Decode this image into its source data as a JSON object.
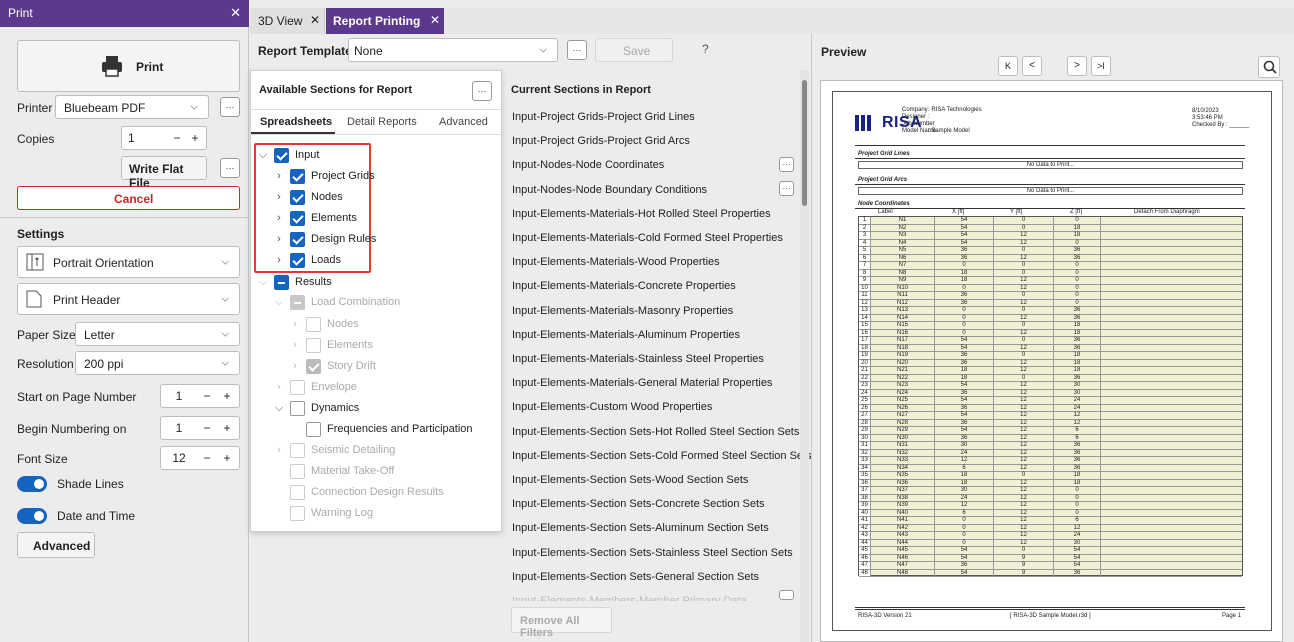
{
  "left_panel": {
    "title": "Print",
    "close": "✕",
    "print_button": "Print",
    "printer_label": "Printer",
    "printer_value": "Bluebeam PDF",
    "copies_label": "Copies",
    "copies_value": "1",
    "write_flat_file": "Write Flat File",
    "cancel": "Cancel",
    "settings_header": "Settings",
    "orientation": "Portrait Orientation",
    "print_header": "Print Header",
    "paper_size_label": "Paper Size",
    "paper_size_value": "Letter",
    "resolution_label": "Resolution",
    "resolution_value": "200 ppi",
    "start_page_label": "Start on Page Number",
    "start_page_value": "1",
    "begin_numbering_label": "Begin Numbering on",
    "begin_numbering_value": "1",
    "font_size_label": "Font Size",
    "font_size_value": "12",
    "shade_lines": "Shade Lines",
    "date_time": "Date and Time",
    "advanced": "Advanced",
    "minus": "−",
    "plus": "+",
    "ellipsis": "···"
  },
  "tabs": [
    {
      "label": "3D View",
      "close": "✕"
    },
    {
      "label": "Report Printing",
      "close": "✕"
    }
  ],
  "toolbar": {
    "templates_label": "Report Templates",
    "templates_value": "None",
    "save": "Save",
    "help": "?"
  },
  "available": {
    "title": "Available Sections for Report",
    "tabs": [
      "Spreadsheets",
      "Detail Reports",
      "Advanced"
    ],
    "tree": [
      "Input",
      "Project Grids",
      "Nodes",
      "Elements",
      "Design Rules",
      "Loads",
      "Results",
      "Load Combination",
      "Nodes",
      "Elements",
      "Story Drift",
      "Envelope",
      "Dynamics",
      "Frequencies and Participation",
      "Seismic Detailing",
      "Material Take-Off",
      "Connection Design Results",
      "Warning Log"
    ]
  },
  "current": {
    "title": "Current Sections in Report",
    "items": [
      "Input-Project Grids-Project Grid Lines",
      "Input-Project Grids-Project Grid Arcs",
      "Input-Nodes-Node Coordinates",
      "Input-Nodes-Node Boundary Conditions",
      "Input-Elements-Materials-Hot Rolled Steel Properties",
      "Input-Elements-Materials-Cold Formed Steel Properties",
      "Input-Elements-Materials-Wood Properties",
      "Input-Elements-Materials-Concrete Properties",
      "Input-Elements-Materials-Masonry Properties",
      "Input-Elements-Materials-Aluminum Properties",
      "Input-Elements-Materials-Stainless Steel Properties",
      "Input-Elements-Materials-General Material Properties",
      "Input-Elements-Custom Wood Properties",
      "Input-Elements-Section Sets-Hot Rolled Steel Section Sets",
      "Input-Elements-Section Sets-Cold Formed Steel Section Sets",
      "Input-Elements-Section Sets-Wood Section Sets",
      "Input-Elements-Section Sets-Concrete Section Sets",
      "Input-Elements-Section Sets-Aluminum Section Sets",
      "Input-Elements-Section Sets-Stainless Steel Section Sets",
      "Input-Elements-Section Sets-General Section Sets",
      "Input-Elements-Members-Member Primary Data"
    ],
    "remove_all": "Remove All Filters"
  },
  "preview": {
    "title": "Preview",
    "nav": [
      "K",
      "<",
      ">",
      ">I"
    ],
    "logo": "RISA",
    "company_labels": [
      "Company",
      "Designer",
      "Job Number",
      "Model Name"
    ],
    "company_values": [
      ": RISA Technologies",
      ":",
      ":",
      ": Sample Model"
    ],
    "date": "8/10/2023",
    "time": "3:53:46 PM",
    "checked_by": "Checked By :",
    "grid_lines_title": "Project Grid Lines",
    "grid_arcs_title": "Project Grid Arcs",
    "no_data": "No Data to Print...",
    "node_coords_title": "Node Coordinates",
    "col_headers": [
      "Label",
      "X [ft]",
      "Y [ft]",
      "Z [ft]",
      "Detach From Diaphragm"
    ],
    "rows": [
      [
        "1",
        "N1",
        "54",
        "0",
        "0"
      ],
      [
        "2",
        "N2",
        "54",
        "0",
        "18"
      ],
      [
        "3",
        "N3",
        "54",
        "12",
        "18"
      ],
      [
        "4",
        "N4",
        "54",
        "12",
        "0"
      ],
      [
        "5",
        "N5",
        "36",
        "0",
        "36"
      ],
      [
        "6",
        "N6",
        "36",
        "12",
        "36"
      ],
      [
        "7",
        "N7",
        "0",
        "0",
        "0"
      ],
      [
        "8",
        "N8",
        "18",
        "0",
        "0"
      ],
      [
        "9",
        "N9",
        "18",
        "12",
        "0"
      ],
      [
        "10",
        "N10",
        "0",
        "12",
        "0"
      ],
      [
        "11",
        "N11",
        "36",
        "0",
        "0"
      ],
      [
        "12",
        "N12",
        "36",
        "12",
        "0"
      ],
      [
        "13",
        "N13",
        "0",
        "0",
        "36"
      ],
      [
        "14",
        "N14",
        "0",
        "12",
        "36"
      ],
      [
        "15",
        "N15",
        "0",
        "0",
        "18"
      ],
      [
        "16",
        "N16",
        "0",
        "12",
        "18"
      ],
      [
        "17",
        "N17",
        "54",
        "0",
        "36"
      ],
      [
        "18",
        "N18",
        "54",
        "12",
        "36"
      ],
      [
        "19",
        "N19",
        "36",
        "0",
        "18"
      ],
      [
        "20",
        "N20",
        "36",
        "12",
        "18"
      ],
      [
        "21",
        "N21",
        "18",
        "12",
        "18"
      ],
      [
        "22",
        "N22",
        "18",
        "0",
        "36"
      ],
      [
        "23",
        "N23",
        "54",
        "12",
        "30"
      ],
      [
        "24",
        "N24",
        "36",
        "12",
        "30"
      ],
      [
        "25",
        "N25",
        "54",
        "12",
        "24"
      ],
      [
        "26",
        "N26",
        "36",
        "12",
        "24"
      ],
      [
        "27",
        "N27",
        "54",
        "12",
        "12"
      ],
      [
        "28",
        "N28",
        "36",
        "12",
        "12"
      ],
      [
        "29",
        "N29",
        "54",
        "12",
        "6"
      ],
      [
        "30",
        "N30",
        "36",
        "12",
        "6"
      ],
      [
        "31",
        "N31",
        "30",
        "12",
        "36"
      ],
      [
        "32",
        "N32",
        "24",
        "12",
        "36"
      ],
      [
        "33",
        "N33",
        "12",
        "12",
        "36"
      ],
      [
        "34",
        "N34",
        "6",
        "12",
        "36"
      ],
      [
        "35",
        "N35",
        "18",
        "0",
        "18"
      ],
      [
        "36",
        "N36",
        "18",
        "12",
        "18"
      ],
      [
        "37",
        "N37",
        "30",
        "12",
        "0"
      ],
      [
        "38",
        "N38",
        "24",
        "12",
        "0"
      ],
      [
        "39",
        "N39",
        "12",
        "12",
        "0"
      ],
      [
        "40",
        "N40",
        "6",
        "12",
        "0"
      ],
      [
        "41",
        "N41",
        "0",
        "12",
        "6"
      ],
      [
        "42",
        "N42",
        "0",
        "12",
        "12"
      ],
      [
        "43",
        "N43",
        "0",
        "12",
        "24"
      ],
      [
        "44",
        "N44",
        "0",
        "12",
        "30"
      ],
      [
        "45",
        "N45",
        "54",
        "0",
        "54"
      ],
      [
        "46",
        "N46",
        "54",
        "9",
        "54"
      ],
      [
        "47",
        "N47",
        "36",
        "9",
        "54"
      ],
      [
        "48",
        "N48",
        "54",
        "9",
        "36"
      ]
    ],
    "footer_left": "RISA-3D Version 21",
    "footer_mid": "[ RISA-3D Sample Model.r3d ]",
    "footer_right": "Page 1"
  }
}
